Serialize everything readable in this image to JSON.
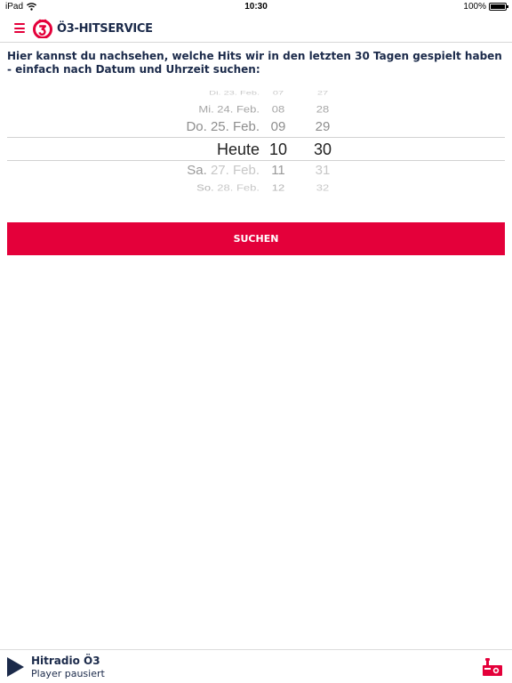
{
  "status_bar": {
    "device": "iPad",
    "time": "10:30",
    "battery": "100%"
  },
  "header": {
    "title": "Ö3-HITSERVICE",
    "accent_color": "#e4003a",
    "text_color": "#1b2a4a"
  },
  "intro": {
    "text": "Hier kannst du nachsehen, welche Hits wir in den letzten 30 Tagen gespielt haben - einfach nach Datum und Uhrzeit suchen:"
  },
  "picker": {
    "rows": [
      {
        "day": "Di. 23. Feb.",
        "hour": "07",
        "minute": "27"
      },
      {
        "day": "Mi. 24. Feb.",
        "hour": "08",
        "minute": "28"
      },
      {
        "day": "Do. 25. Feb.",
        "hour": "09",
        "minute": "29"
      },
      {
        "day": "Heute",
        "hour": "10",
        "minute": "30"
      },
      {
        "day_prefix": "Sa.",
        "day_rest": "27. Feb.",
        "hour": "11",
        "minute": "31"
      },
      {
        "day_prefix": "So.",
        "day_rest": "28. Feb.",
        "hour": "12",
        "minute": "32"
      }
    ]
  },
  "search_button": {
    "label": "SUCHEN"
  },
  "player": {
    "station": "Hitradio Ö3",
    "status": "Player pausiert"
  }
}
